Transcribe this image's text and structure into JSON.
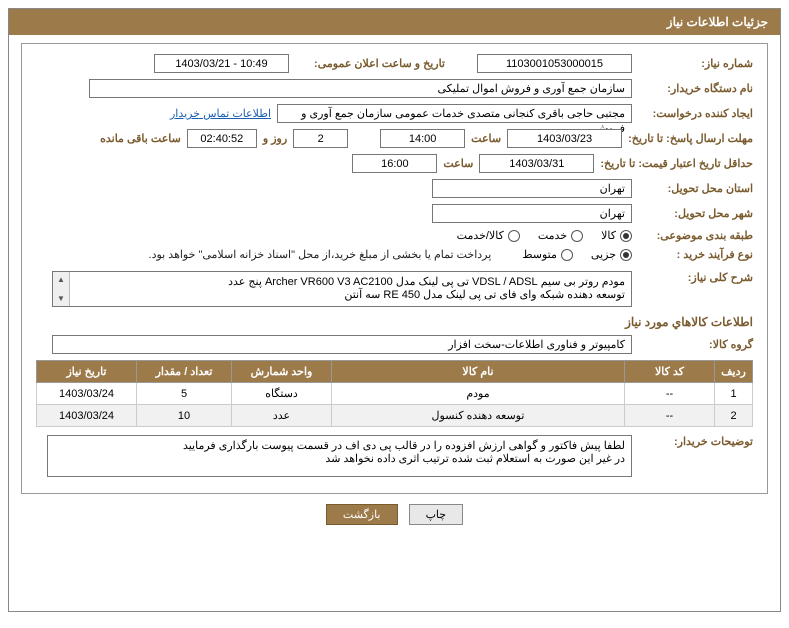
{
  "title": "جزئیات اطلاعات نیاز",
  "labels": {
    "needNo": "شماره نیاز:",
    "announceDateTime": "تاریخ و ساعت اعلان عمومی:",
    "buyerOrg": "نام دستگاه خریدار:",
    "requester": "ایجاد کننده درخواست:",
    "contactLink": "اطلاعات تماس خریدار",
    "responseDeadline": "مهلت ارسال پاسخ: تا تاریخ:",
    "hour": "ساعت",
    "dayAnd": "روز و",
    "remaining": "ساعت باقی مانده",
    "priceValidity": "حداقل تاریخ اعتبار قیمت: تا تاریخ:",
    "deliveryProvince": "استان محل تحویل:",
    "deliveryCity": "شهر محل تحویل:",
    "subjectClass": "طبقه بندی موضوعی:",
    "goods": "کالا",
    "service": "خدمت",
    "goodsService": "کالا/خدمت",
    "purchaseType": "نوع فرآیند خرید :",
    "partial": "جزیی",
    "medium": "متوسط",
    "treasuryNote": "پرداخت تمام یا بخشی از مبلغ خرید،از محل \"اسناد خزانه اسلامی\" خواهد بود.",
    "needSummary": "شرح کلی نیاز:",
    "itemsHead": "اطلاعات کالاهاي مورد نياز",
    "goodsGroup": "گروه کالا:",
    "buyerNotes": "توضیحات خریدار:",
    "print": "چاپ",
    "back": "بازگشت"
  },
  "values": {
    "needNo": "1103001053000015",
    "announceDateTime": "1403/03/21 - 10:49",
    "buyerOrg": "سازمان جمع آوری و فروش اموال تملیکی",
    "requester": "مجتبی حاجی باقری کنجانی متصدی خدمات عمومی سازمان جمع آوری و فروش",
    "responseDate": "1403/03/23",
    "responseHour": "14:00",
    "remainDays": "2",
    "remainClock": "02:40:52",
    "priceValidDate": "1403/03/31",
    "priceValidHour": "16:00",
    "province": "تهران",
    "city": "تهران",
    "summary1": "مودم روتر بی سیم VDSL / ADSL تی پی لینک مدل Archer VR600 V3 AC2100 پنج عدد",
    "summary2": "توسعه دهنده شبکه وای فای تی پی لینک مدل RE 450 سه آنتن",
    "goodsGroup": "کامپیوتر و فناوری اطلاعات-سخت افزار",
    "buyerNotes1": "لطفا پیش فاکتور و گواهی ارزش افزوده را در قالب پی دی اف در قسمت پیوست بارگذاری فرمایید",
    "buyerNotes2": "در غیر این صورت به استعلام ثبت شده ترتیب اثری داده نخواهد شد"
  },
  "table": {
    "headers": {
      "row": "رديف",
      "code": "کد کالا",
      "name": "نام کالا",
      "unit": "واحد شمارش",
      "qty": "تعداد / مقدار",
      "needDate": "تاريخ نياز"
    },
    "rows": [
      {
        "n": "1",
        "code": "--",
        "name": "مودم",
        "unit": "دستگاه",
        "qty": "5",
        "date": "1403/03/24"
      },
      {
        "n": "2",
        "code": "--",
        "name": "توسعه دهنده کنسول",
        "unit": "عدد",
        "qty": "10",
        "date": "1403/03/24"
      }
    ]
  }
}
